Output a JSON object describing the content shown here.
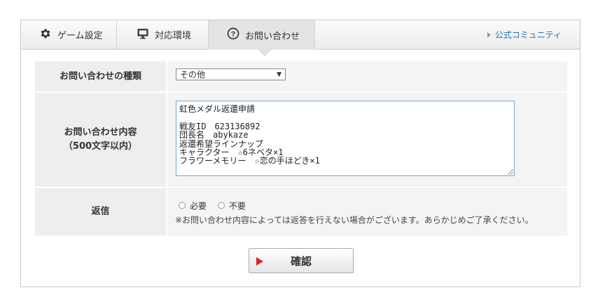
{
  "tabs": {
    "game_settings": "ゲーム設定",
    "environment": "対応環境",
    "contact": "お問い合わせ"
  },
  "community_link": "公式コミュニティ",
  "form": {
    "type_label": "お問い合わせの種類",
    "type_value": "その他",
    "body_label_1": "お問い合わせ内容",
    "body_label_2": "（500文字以内）",
    "body_text": "虹色メダル返還申請\n\n戦友ID　623136892\n団長名　abykaze\n返還希望ラインナップ\nキャラクター　☆6ネベタ×1\nフラワーメモリー　☆恋の手ほどき×1",
    "reply_label": "返信",
    "reply_required": "必要",
    "reply_not_required": "不要",
    "reply_note": "※お問い合わせ内容によっては返答を行えない場合がございます。あらかじめご了承ください。"
  },
  "confirm_label": "確認",
  "icons": {
    "game_settings": "gear-icon",
    "environment": "monitor-icon",
    "contact": "question-circle-icon",
    "community": "triangle-right-icon",
    "confirm": "play-icon"
  },
  "colors": {
    "accent_link": "#2a6fb5",
    "confirm_play": "#d9222a",
    "textarea_border": "#7da2ce"
  }
}
